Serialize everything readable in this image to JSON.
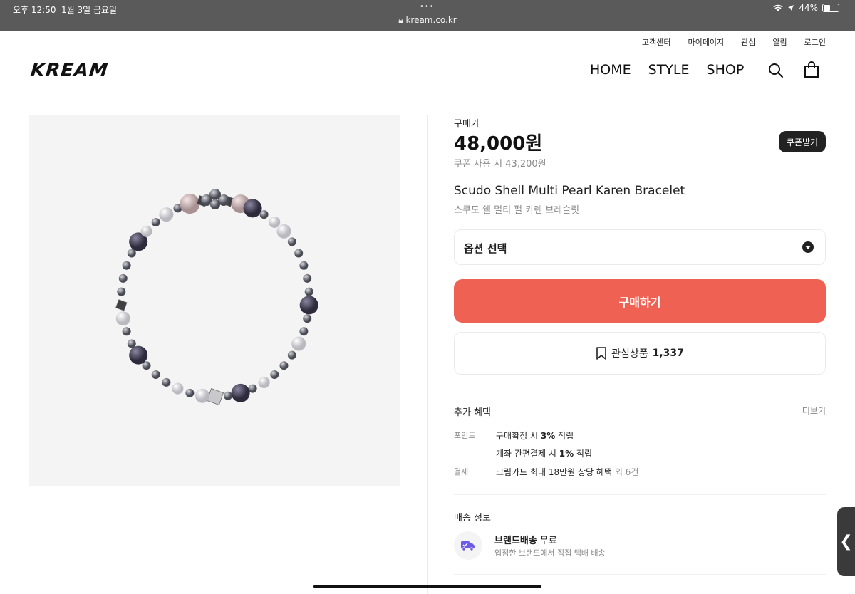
{
  "status": {
    "time": "오후 12:50",
    "date": "1월 3일 금요일",
    "url": "kream.co.kr",
    "battery": "44%",
    "battery_level": 0.44
  },
  "header": {
    "utility": [
      "고객센터",
      "마이페이지",
      "관심",
      "알림",
      "로그인"
    ],
    "logo": "KREAM",
    "nav": [
      "HOME",
      "STYLE",
      "SHOP"
    ]
  },
  "product": {
    "price_label": "구매가",
    "price": "48,000원",
    "coupon_price": "쿠폰 사용 시 43,200원",
    "coupon_button": "쿠폰받기",
    "name_en": "Scudo Shell Multi Pearl Karen Bracelet",
    "name_ko": "스쿠도 쉘 멀티 펄 카렌 브레슬릿",
    "option_label": "옵션 선택",
    "buy_label": "구매하기",
    "wish_label": "관심상품",
    "wish_count": "1,337"
  },
  "benefits": {
    "title": "추가 혜택",
    "more": "더보기",
    "point_key": "포인트",
    "point_1_pre": "구매확정 시 ",
    "point_1_bold": "3%",
    "point_1_post": " 적립",
    "point_2_pre": "계좌 간편결제 시 ",
    "point_2_bold": "1%",
    "point_2_post": " 적립",
    "pay_key": "결제",
    "pay_text": "크림카드 최대 18만원 상당 혜택",
    "pay_extra": " 외 6건"
  },
  "shipping": {
    "title": "배송 정보",
    "name_bold": "브랜드배송",
    "name_rest": " 무료",
    "desc": "입점한 브랜드에서 직접 택배 배송"
  },
  "side_tab": "❮",
  "colors": {
    "buy": "#ef6253",
    "dark": "#222222",
    "muted": "#888888"
  }
}
